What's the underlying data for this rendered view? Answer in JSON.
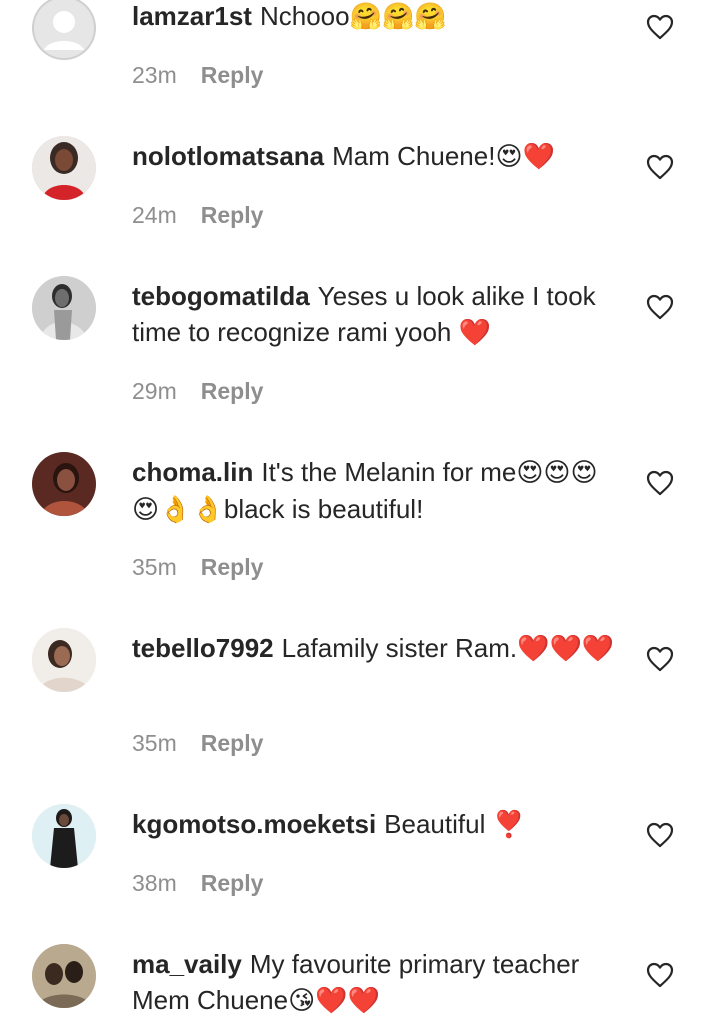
{
  "comments": [
    {
      "username": "lamzar1st",
      "text": "Nchooo",
      "emoji": "🤗🤗🤗",
      "time": "23m",
      "reply": "Reply",
      "avatar": "default-avatar"
    },
    {
      "username": "nolotlomatsana",
      "text": "Mam Chuene!",
      "emoji": "😍❤️",
      "time": "24m",
      "reply": "Reply",
      "avatar": "profile-photo"
    },
    {
      "username": "tebogomatilda",
      "text": "Yeses u look alike I took time to recognize rami yooh",
      "emoji": "❤️",
      "time": "29m",
      "reply": "Reply",
      "avatar": "profile-photo"
    },
    {
      "username": "choma.lin",
      "text": "It's the Melanin for me",
      "emoji": "😍😍😍😍👌👌",
      "text2": "black is beautiful!",
      "time": "35m",
      "reply": "Reply",
      "avatar": "profile-photo"
    },
    {
      "username": "tebello7992",
      "text": "Lafamily sister Ram.",
      "emoji": "❤️❤️❤️",
      "time": "35m",
      "reply": "Reply",
      "avatar": "profile-photo"
    },
    {
      "username": "kgomotso.moeketsi",
      "text": "Beautiful",
      "emoji": "❣️",
      "time": "38m",
      "reply": "Reply",
      "avatar": "profile-photo"
    },
    {
      "username": "ma_vaily",
      "text": "My favourite primary teacher Mem Chuene",
      "emoji": "😘❤️❤️",
      "avatar": "profile-photo"
    }
  ],
  "icons": {
    "like": "heart-outline-icon",
    "default_avatar": "person-silhouette-icon"
  },
  "colors": {
    "text": "#262626",
    "meta": "#8e8e8e",
    "background": "#ffffff"
  }
}
